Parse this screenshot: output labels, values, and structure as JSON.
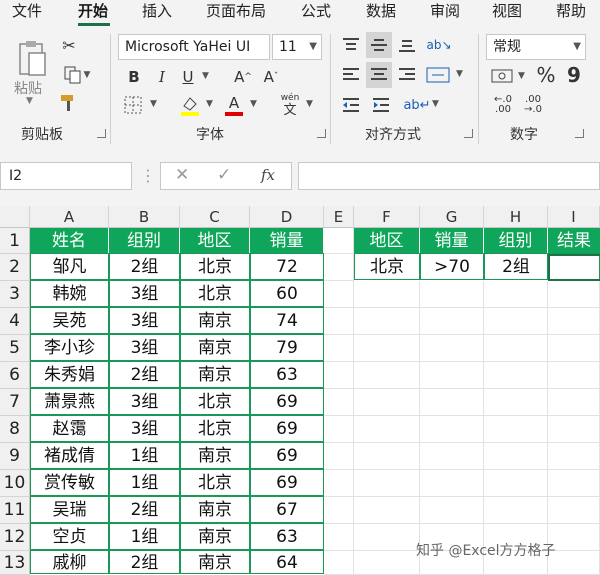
{
  "ribbon_tabs": [
    "文件",
    "开始",
    "插入",
    "页面布局",
    "公式",
    "数据",
    "审阅",
    "视图",
    "帮助"
  ],
  "active_tab": "开始",
  "clipboard": {
    "paste_label": "粘贴",
    "group_label": "剪贴板"
  },
  "font": {
    "name": "Microsoft YaHei UI",
    "size": "11",
    "bold": "B",
    "italic": "I",
    "underline": "U",
    "grow": "A",
    "shrink": "A",
    "group_label": "字体",
    "phonetic": "wén",
    "phonetic_char": "文"
  },
  "alignment": {
    "group_label": "对齐方式"
  },
  "number": {
    "format": "常规",
    "percent": "%",
    "comma": "9",
    "group_label": "数字",
    "currency": "¥"
  },
  "formula_bar": {
    "name_box": "I2",
    "formula": "",
    "fx": "fx"
  },
  "columns": [
    "A",
    "B",
    "C",
    "D",
    "E",
    "F",
    "G",
    "H",
    "I"
  ],
  "rows": [
    "1",
    "2",
    "3",
    "4",
    "5",
    "6",
    "7",
    "8",
    "9",
    "10",
    "11",
    "12",
    "13"
  ],
  "table_headers": [
    "姓名",
    "组别",
    "地区",
    "销量"
  ],
  "table_rows": [
    [
      "邹凡",
      "2组",
      "北京",
      "72"
    ],
    [
      "韩婉",
      "3组",
      "北京",
      "60"
    ],
    [
      "吴苑",
      "3组",
      "南京",
      "74"
    ],
    [
      "李小珍",
      "3组",
      "南京",
      "79"
    ],
    [
      "朱秀娟",
      "2组",
      "南京",
      "63"
    ],
    [
      "萧景燕",
      "3组",
      "北京",
      "69"
    ],
    [
      "赵霭",
      "3组",
      "北京",
      "69"
    ],
    [
      "褚成倩",
      "1组",
      "南京",
      "69"
    ],
    [
      "赏传敏",
      "1组",
      "北京",
      "69"
    ],
    [
      "吴瑞",
      "2组",
      "南京",
      "67"
    ],
    [
      "空贞",
      "1组",
      "南京",
      "63"
    ],
    [
      "戚柳",
      "2组",
      "南京",
      "64"
    ]
  ],
  "criteria_headers": [
    "地区",
    "销量",
    "组别",
    "结果"
  ],
  "criteria_values": [
    "北京",
    ">70",
    "2组",
    ""
  ],
  "watermark": "知乎 @Excel方方格子",
  "colors": {
    "header_green": "#0fa55a",
    "border_green": "#19985a",
    "accent": "#1e7145"
  }
}
